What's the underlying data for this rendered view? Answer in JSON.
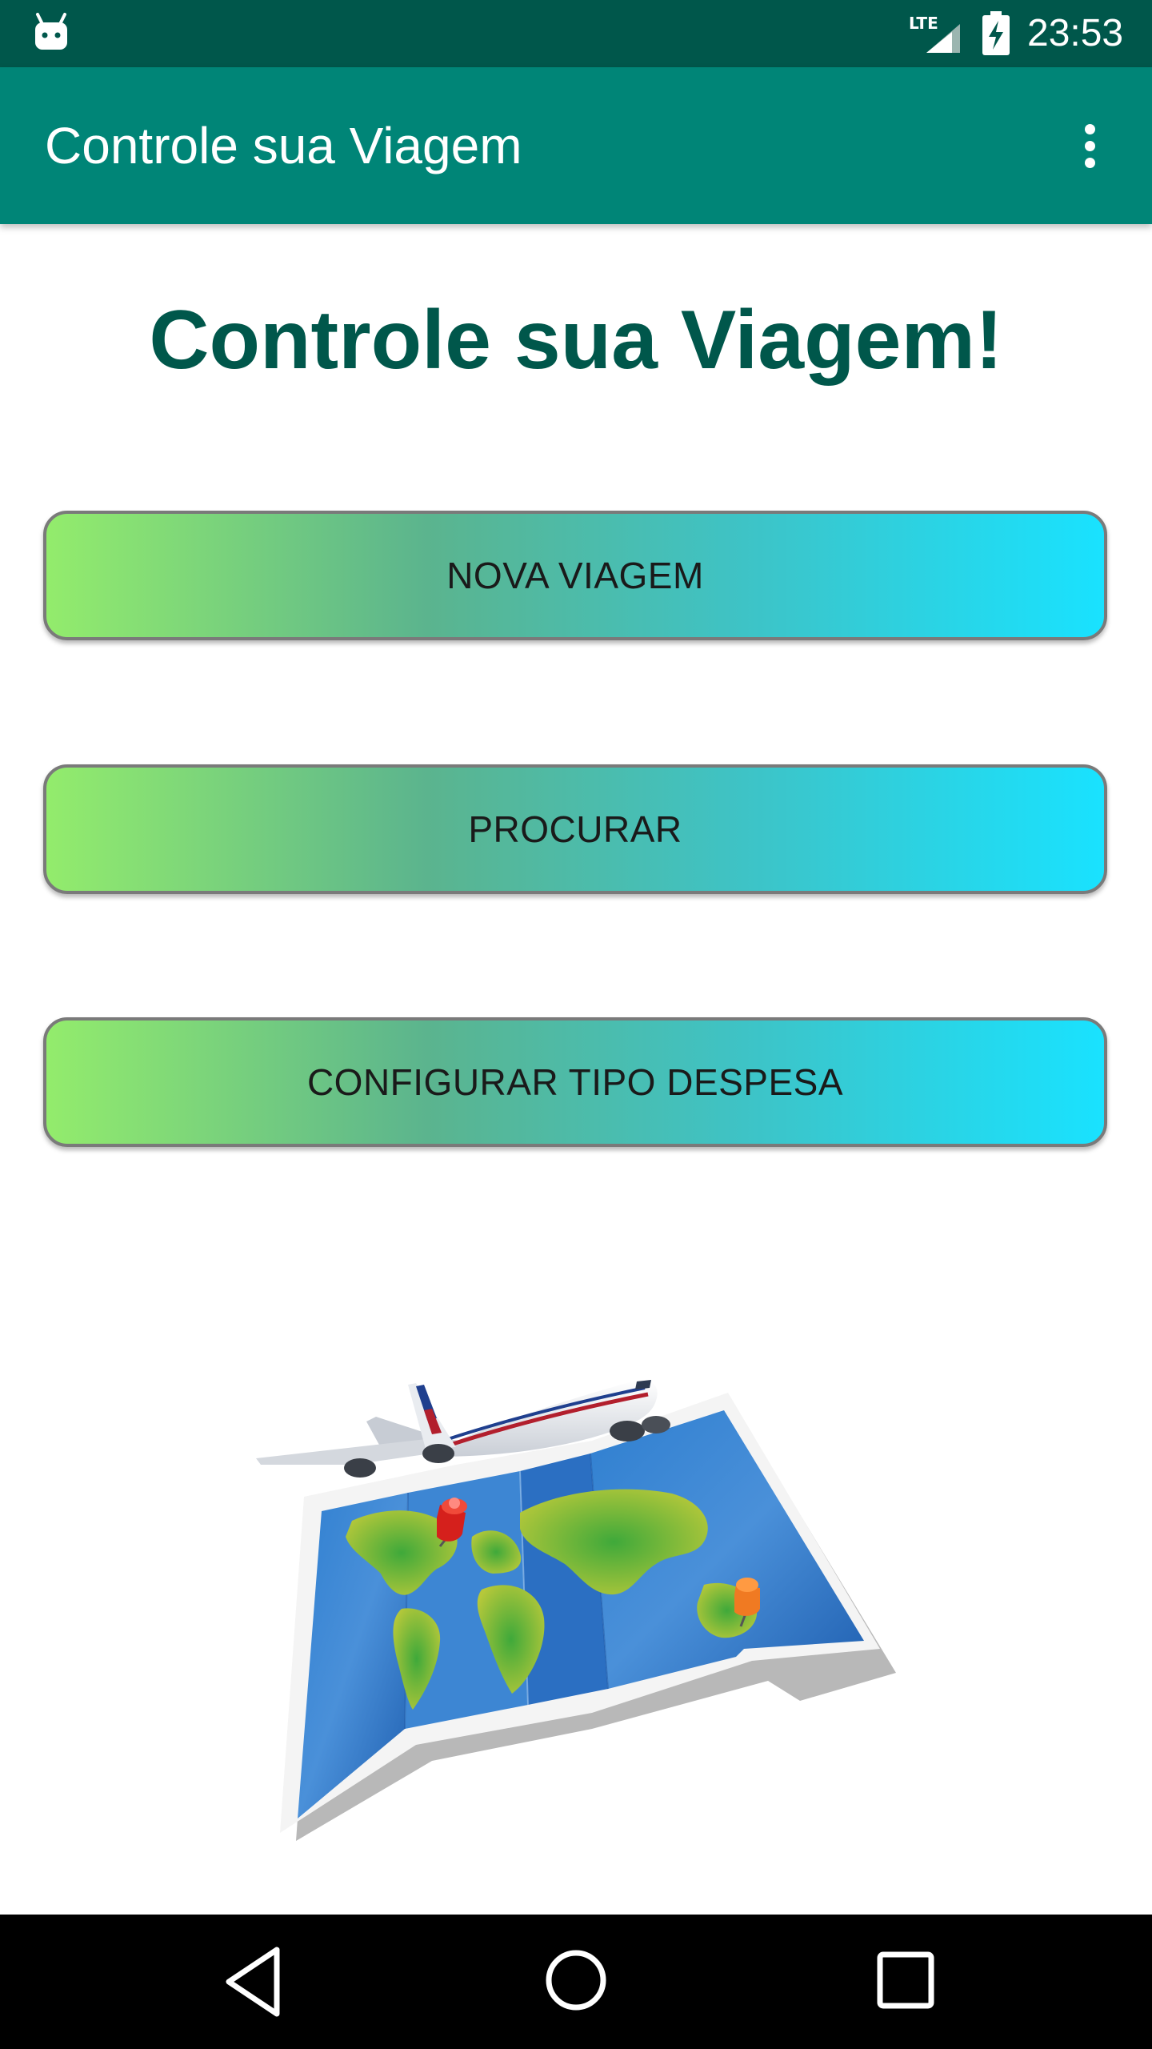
{
  "status_bar": {
    "time": "23:53",
    "network_label": "LTE",
    "icons": [
      "android-notification-icon",
      "lte-signal-icon",
      "battery-charging-icon"
    ]
  },
  "app_bar": {
    "title": "Controle sua Viagem",
    "menu_icon": "overflow-menu-icon"
  },
  "main": {
    "heading": "Controle sua Viagem!",
    "buttons": [
      {
        "label": "NOVA VIAGEM"
      },
      {
        "label": "PROCURAR"
      },
      {
        "label": "CONFIGURAR TIPO DESPESA"
      }
    ],
    "illustration": "airplane-over-world-map-icon"
  },
  "nav_bar": {
    "icons": [
      "back-icon",
      "home-icon",
      "recents-icon"
    ]
  },
  "colors": {
    "status_bar": "#00574B",
    "app_bar": "#008577",
    "heading": "#00574B",
    "button_gradient_start": "#93EC6C",
    "button_gradient_end": "#19E2FF"
  }
}
